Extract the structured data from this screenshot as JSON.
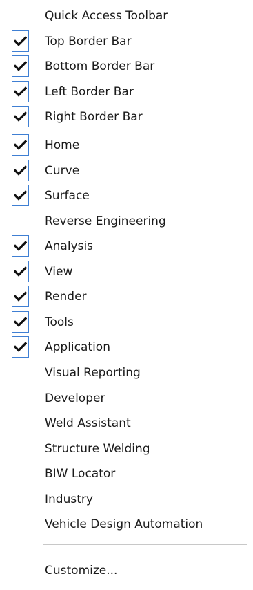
{
  "menu": {
    "group1": [
      {
        "label": "Quick Access Toolbar",
        "checked": false
      },
      {
        "label": "Top Border Bar",
        "checked": true
      },
      {
        "label": "Bottom Border Bar",
        "checked": true
      },
      {
        "label": "Left Border Bar",
        "checked": true
      },
      {
        "label": "Right Border Bar",
        "checked": true
      }
    ],
    "group2": [
      {
        "label": "Home",
        "checked": true
      },
      {
        "label": "Curve",
        "checked": true
      },
      {
        "label": "Surface",
        "checked": true
      },
      {
        "label": "Reverse Engineering",
        "checked": false
      },
      {
        "label": "Analysis",
        "checked": true
      },
      {
        "label": "View",
        "checked": true
      },
      {
        "label": "Render",
        "checked": true
      },
      {
        "label": "Tools",
        "checked": true
      },
      {
        "label": "Application",
        "checked": true
      },
      {
        "label": "Visual Reporting",
        "checked": false
      },
      {
        "label": "Developer",
        "checked": false
      },
      {
        "label": "Weld Assistant",
        "checked": false
      },
      {
        "label": "Structure Welding",
        "checked": false
      },
      {
        "label": "BIW Locator",
        "checked": false
      },
      {
        "label": "Industry",
        "checked": false
      },
      {
        "label": "Vehicle Design Automation",
        "checked": false
      }
    ],
    "group3": [
      {
        "label": "Customize...",
        "checked": false
      }
    ]
  },
  "icons": {
    "check": "checkmark-icon"
  },
  "colors": {
    "check_box_border": "#3f7fd3",
    "text": "#1a1a1a",
    "separator": "#c8c8c8"
  }
}
